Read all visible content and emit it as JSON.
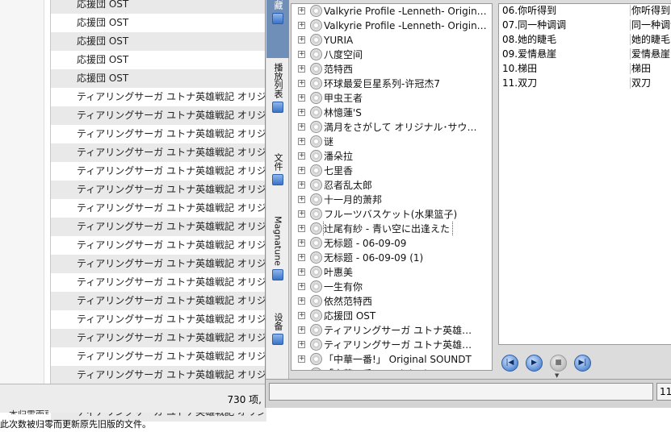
{
  "background_table": {
    "rows": [
      "応援団 OST",
      "応援団 OST",
      "応援団 OST",
      "応援団 OST",
      "応援団 OST",
      "ティアリングサーガ ユトナ英雄戦記 オリジナル",
      "ティアリングサーガ ユトナ英雄戦記 オリジナル",
      "ティアリングサーガ ユトナ英雄戦記 オリジナル",
      "ティアリングサーガ ユトナ英雄戦記 オリジナル",
      "ティアリングサーガ ユトナ英雄戦記 オリジナル",
      "ティアリングサーガ ユトナ英雄戦記 オリジナル",
      "ティアリングサーガ ユトナ英雄戦記 オリジナル",
      "ティアリングサーガ ユトナ英雄戦記 オリジナル",
      "ティアリングサーガ ユトナ英雄戦記 オリジナル",
      "ティアリングサーガ ユトナ英雄戦記 オリジナル",
      "ティアリングサーガ ユトナ英雄戦記 オリジナル",
      "ティアリングサーガ ユトナ英雄戦記 オリジナル",
      "ティアリングサーガ ユトナ英雄戦記 オリジナル",
      "ティアリングサーガ ユトナ英雄戦記 オリジナル",
      "ティアリングサーガ ユトナ英雄戦記 オリジナル",
      "ティアリングサーガ ユトナ英雄戦記 オリジナル",
      "ティアリングサーガ ユトナ英雄戦記 オリジナル",
      "ティアリングサーガ ユトナ英雄戦記 オリジナル"
    ],
    "item_count": "730 项,",
    "bottom_line_0": "…本归零而更新…",
    "bottom_line_1": "此次数被归零而更新原先旧版的文件。"
  },
  "side_tabs": {
    "collection": "收藏",
    "playlist": "播放列表",
    "files": "文件",
    "magnatune": "Magnatune",
    "devices": "设备"
  },
  "collection_tree": [
    "Valkyrie Profile -Lenneth- Origin…",
    "Valkyrie Profile -Lenneth- Origin…",
    "YURIA",
    "八度空间",
    "范特西",
    "环球最爱巨星系列-许冠杰7",
    "甲虫王者",
    "林憶蓮'S",
    "満月をさがして オリジナル･サウ…",
    "谜",
    "潘朵拉",
    "七里香",
    "忍者乱太郎",
    "十一月的萧邦",
    "フルーツバスケット(水果篮子)",
    "辻尾有紗 - 青い空に出逢えた",
    "无标题 - 06-09-09",
    "无标题 - 06-09-09 (1)",
    "叶惠美",
    "一生有你",
    "依然范特西",
    "応援団 OST",
    "ティアリングサーガ ユトナ英雄…",
    "ティアリングサーガ ユトナ英雄…",
    "「中華一番!」 Original SOUNDT",
    "「中華一番!」 Original SOUND…"
  ],
  "selected_tree_index": 15,
  "playlist": [
    {
      "title": "06.你听得到",
      "col2": "你听得到"
    },
    {
      "title": "07.同一种调调",
      "col2": "同一种调调"
    },
    {
      "title": "08.她的睫毛",
      "col2": "她的睫毛"
    },
    {
      "title": "09.爱情悬崖",
      "col2": "爱情悬崖"
    },
    {
      "title": "10.梯田",
      "col2": "梯田"
    },
    {
      "title": "11.双刀",
      "col2": "双刀"
    }
  ],
  "transport": {
    "prev_icon": "previous-track-icon",
    "play_icon": "play-icon",
    "stop_icon": "stop-icon",
    "next_icon": "next-track-icon"
  },
  "filter_value": "",
  "playlist_count": "11",
  "colors": {
    "accent": "#3a73c8",
    "selected_tab": "#6f8fb8",
    "alt_row": "#e9e9e9"
  }
}
